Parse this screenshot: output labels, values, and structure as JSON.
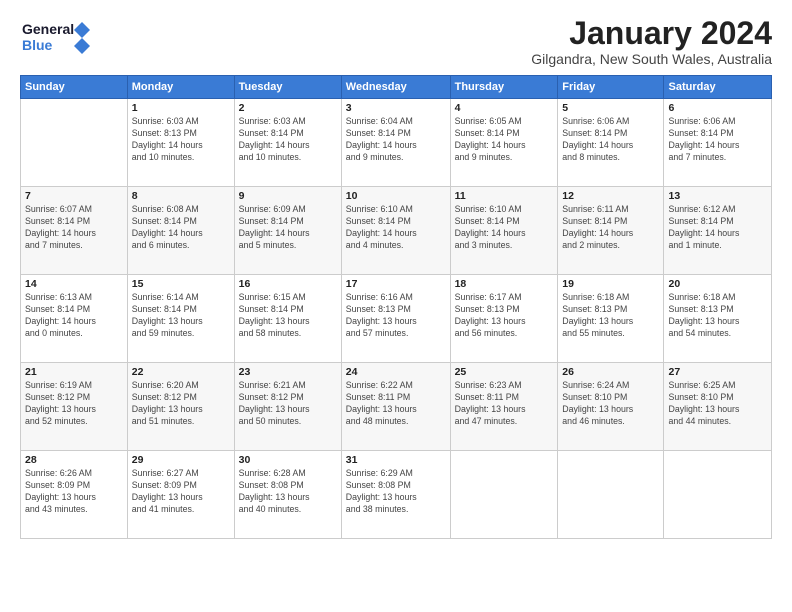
{
  "logo": {
    "line1": "General",
    "line2": "Blue"
  },
  "title": "January 2024",
  "location": "Gilgandra, New South Wales, Australia",
  "days_of_week": [
    "Sunday",
    "Monday",
    "Tuesday",
    "Wednesday",
    "Thursday",
    "Friday",
    "Saturday"
  ],
  "weeks": [
    [
      {
        "day": "",
        "info": ""
      },
      {
        "day": "1",
        "info": "Sunrise: 6:03 AM\nSunset: 8:13 PM\nDaylight: 14 hours\nand 10 minutes."
      },
      {
        "day": "2",
        "info": "Sunrise: 6:03 AM\nSunset: 8:14 PM\nDaylight: 14 hours\nand 10 minutes."
      },
      {
        "day": "3",
        "info": "Sunrise: 6:04 AM\nSunset: 8:14 PM\nDaylight: 14 hours\nand 9 minutes."
      },
      {
        "day": "4",
        "info": "Sunrise: 6:05 AM\nSunset: 8:14 PM\nDaylight: 14 hours\nand 9 minutes."
      },
      {
        "day": "5",
        "info": "Sunrise: 6:06 AM\nSunset: 8:14 PM\nDaylight: 14 hours\nand 8 minutes."
      },
      {
        "day": "6",
        "info": "Sunrise: 6:06 AM\nSunset: 8:14 PM\nDaylight: 14 hours\nand 7 minutes."
      }
    ],
    [
      {
        "day": "7",
        "info": "Sunrise: 6:07 AM\nSunset: 8:14 PM\nDaylight: 14 hours\nand 7 minutes."
      },
      {
        "day": "8",
        "info": "Sunrise: 6:08 AM\nSunset: 8:14 PM\nDaylight: 14 hours\nand 6 minutes."
      },
      {
        "day": "9",
        "info": "Sunrise: 6:09 AM\nSunset: 8:14 PM\nDaylight: 14 hours\nand 5 minutes."
      },
      {
        "day": "10",
        "info": "Sunrise: 6:10 AM\nSunset: 8:14 PM\nDaylight: 14 hours\nand 4 minutes."
      },
      {
        "day": "11",
        "info": "Sunrise: 6:10 AM\nSunset: 8:14 PM\nDaylight: 14 hours\nand 3 minutes."
      },
      {
        "day": "12",
        "info": "Sunrise: 6:11 AM\nSunset: 8:14 PM\nDaylight: 14 hours\nand 2 minutes."
      },
      {
        "day": "13",
        "info": "Sunrise: 6:12 AM\nSunset: 8:14 PM\nDaylight: 14 hours\nand 1 minute."
      }
    ],
    [
      {
        "day": "14",
        "info": "Sunrise: 6:13 AM\nSunset: 8:14 PM\nDaylight: 14 hours\nand 0 minutes."
      },
      {
        "day": "15",
        "info": "Sunrise: 6:14 AM\nSunset: 8:14 PM\nDaylight: 13 hours\nand 59 minutes."
      },
      {
        "day": "16",
        "info": "Sunrise: 6:15 AM\nSunset: 8:14 PM\nDaylight: 13 hours\nand 58 minutes."
      },
      {
        "day": "17",
        "info": "Sunrise: 6:16 AM\nSunset: 8:13 PM\nDaylight: 13 hours\nand 57 minutes."
      },
      {
        "day": "18",
        "info": "Sunrise: 6:17 AM\nSunset: 8:13 PM\nDaylight: 13 hours\nand 56 minutes."
      },
      {
        "day": "19",
        "info": "Sunrise: 6:18 AM\nSunset: 8:13 PM\nDaylight: 13 hours\nand 55 minutes."
      },
      {
        "day": "20",
        "info": "Sunrise: 6:18 AM\nSunset: 8:13 PM\nDaylight: 13 hours\nand 54 minutes."
      }
    ],
    [
      {
        "day": "21",
        "info": "Sunrise: 6:19 AM\nSunset: 8:12 PM\nDaylight: 13 hours\nand 52 minutes."
      },
      {
        "day": "22",
        "info": "Sunrise: 6:20 AM\nSunset: 8:12 PM\nDaylight: 13 hours\nand 51 minutes."
      },
      {
        "day": "23",
        "info": "Sunrise: 6:21 AM\nSunset: 8:12 PM\nDaylight: 13 hours\nand 50 minutes."
      },
      {
        "day": "24",
        "info": "Sunrise: 6:22 AM\nSunset: 8:11 PM\nDaylight: 13 hours\nand 48 minutes."
      },
      {
        "day": "25",
        "info": "Sunrise: 6:23 AM\nSunset: 8:11 PM\nDaylight: 13 hours\nand 47 minutes."
      },
      {
        "day": "26",
        "info": "Sunrise: 6:24 AM\nSunset: 8:10 PM\nDaylight: 13 hours\nand 46 minutes."
      },
      {
        "day": "27",
        "info": "Sunrise: 6:25 AM\nSunset: 8:10 PM\nDaylight: 13 hours\nand 44 minutes."
      }
    ],
    [
      {
        "day": "28",
        "info": "Sunrise: 6:26 AM\nSunset: 8:09 PM\nDaylight: 13 hours\nand 43 minutes."
      },
      {
        "day": "29",
        "info": "Sunrise: 6:27 AM\nSunset: 8:09 PM\nDaylight: 13 hours\nand 41 minutes."
      },
      {
        "day": "30",
        "info": "Sunrise: 6:28 AM\nSunset: 8:08 PM\nDaylight: 13 hours\nand 40 minutes."
      },
      {
        "day": "31",
        "info": "Sunrise: 6:29 AM\nSunset: 8:08 PM\nDaylight: 13 hours\nand 38 minutes."
      },
      {
        "day": "",
        "info": ""
      },
      {
        "day": "",
        "info": ""
      },
      {
        "day": "",
        "info": ""
      }
    ]
  ]
}
